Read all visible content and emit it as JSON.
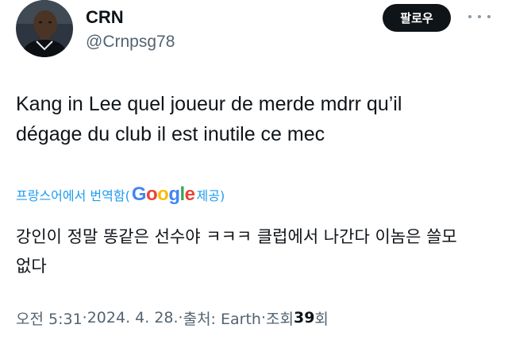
{
  "user": {
    "display_name": "CRN",
    "handle": "@Crnpsg78"
  },
  "follow_label": "팔로우",
  "tweet": {
    "line1": "Kang in Lee quel joueur de merde mdrr qu’il",
    "line2": "dégage du club il est inutile ce mec"
  },
  "translation": {
    "prefix": "프랑스어에서 번역함(",
    "google": [
      "G",
      "o",
      "o",
      "g",
      "l",
      "e"
    ],
    "suffix": " 제공)",
    "line1": "강인이 정말 똥같은 선수야 ㅋㅋㅋ 클럽에서 나간다 이놈은 쓸모",
    "line2": "없다"
  },
  "meta": {
    "time": "오전 5:31",
    "separator": " · ",
    "date": "2024. 4. 28.",
    "source": "출처: Earth",
    "views_prefix": "조회 ",
    "views_count": "39",
    "views_suffix": "회"
  },
  "colors": {
    "link": "#1d9bf0",
    "secondary": "#536471",
    "primary_text": "#0f1419"
  }
}
